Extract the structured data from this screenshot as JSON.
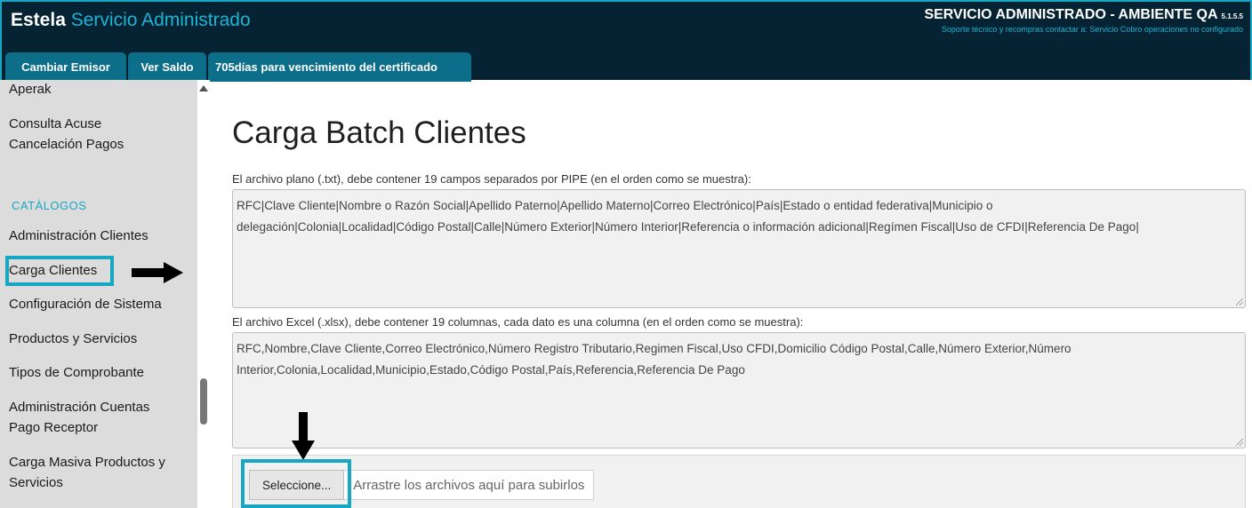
{
  "header": {
    "brand_bold": "Estela",
    "brand_rest": "Servicio Administrado",
    "env_title": "SERVICIO ADMINISTRADO - AMBIENTE QA",
    "version": "5.1.5.5",
    "support_text": "Soporte técnico y recompras contactar a: Servicio Cobro operaciones no configurado"
  },
  "tabs": [
    {
      "label": "Cambiar Emisor"
    },
    {
      "label": "Ver Saldo"
    },
    {
      "label": "705días para vencimiento del certificado"
    }
  ],
  "sidebar": {
    "items": [
      {
        "label": "Aperak"
      },
      {
        "label": "Consulta Acuse"
      },
      {
        "label": "Cancelación Pagos"
      },
      {
        "label": "Administración Clientes"
      },
      {
        "label": "Carga Clientes"
      },
      {
        "label": "Configuración de Sistema"
      },
      {
        "label": "Productos y Servicios"
      },
      {
        "label": "Tipos de Comprobante"
      },
      {
        "label": "Administración Cuentas"
      },
      {
        "label": "Pago Receptor"
      },
      {
        "label": "Carga Masiva Productos y"
      },
      {
        "label": "Servicios"
      }
    ],
    "section_catalogos": "CATÁLOGOS",
    "active_item": "Carga Clientes"
  },
  "main": {
    "title": "Carga Batch Clientes",
    "txt_desc": "El archivo plano (.txt), debe contener 19 campos separados por PIPE (en el orden como se muestra):",
    "txt_line1": "RFC|Clave Cliente|Nombre o Razón Social|Apellido Paterno|Apellido Materno|Correo Electrónico|País|Estado o entidad federativa|Municipio o",
    "txt_line2": "delegación|Colonia|Localidad|Código Postal|Calle|Número Exterior|Número Interior|Referencia o información adicional|Regímen Fiscal|Uso de CFDI|Referencia De Pago|",
    "xlsx_desc": "El archivo Excel (.xlsx), debe contener 19 columnas, cada dato es una columna (en el orden como se muestra):",
    "xlsx_line1": "RFC,Nombre,Clave Cliente,Correo Electrónico,Número Registro Tributario,Regimen Fiscal,Uso CFDI,Domicilio Código Postal,Calle,Número Exterior,Número",
    "xlsx_line2": "Interior,Colonia,Localidad,Municipio,Estado,Código Postal,País,Referencia,Referencia De Pago",
    "select_button": "Seleccione...",
    "drop_text": "Arrastre los archivos aquí para subirlos"
  },
  "colors": {
    "header_bg": "#062333",
    "accent": "#17a7c3",
    "tab_bg": "#0c6e89",
    "sidebar_bg": "#dcdcdc"
  }
}
